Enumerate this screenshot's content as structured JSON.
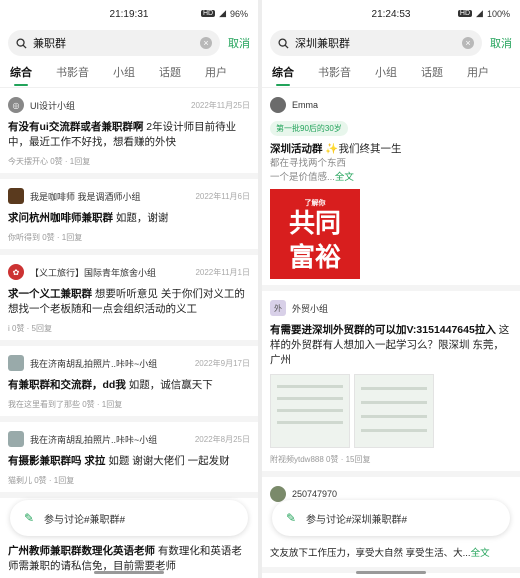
{
  "left": {
    "status": {
      "time": "21:19:31",
      "battery": "96%"
    },
    "search": {
      "query": "兼职群",
      "cancel": "取消"
    },
    "tabs": [
      "综合",
      "书影音",
      "小组",
      "话题",
      "用户"
    ],
    "posts": [
      {
        "group": "UI设计小组",
        "date": "2022年11月25日",
        "title": "有没有ui交流群或者兼职群啊",
        "body": " 2年设计师目前待业中，最近工作不好找，想看赚的外快",
        "stats": "今天摆开心 0赞 · 1回复"
      },
      {
        "group": "我是咖啡师 我是调酒师小组",
        "date": "2022年11月6日",
        "title": "求问杭州咖啡师兼职群",
        "body": " 如题，谢谢",
        "stats": "你听得到 0赞 · 1回复"
      },
      {
        "group": "【义工旅行】国际青年旅舍小组",
        "date": "2022年11月1日",
        "title": "求一个义工兼职群",
        "body": " 想要听听意见 关于你们对义工的 想找一个老板随和一点会组织活动的义工",
        "stats": "i 0赞 · 5回复"
      },
      {
        "group": "我在济南胡乱拍照片..咔咔~小组",
        "date": "2022年9月17日",
        "title": "有兼职群和交流群，dd我",
        "body": " 如题，诚信赢天下",
        "stats": "我在这里看到了那些 0赞 · 1回复"
      },
      {
        "group": "我在济南胡乱拍照片..咔咔~小组",
        "date": "2022年8月25日",
        "title": "有摄影兼职群吗 求拉",
        "body": " 如题 谢谢大佬们 一起发财",
        "stats": "猫剩儿 0赞 · 1回复"
      },
      {
        "group": "",
        "date": "",
        "title": "广州教师兼职群数理化英语老师",
        "body": " 有数理化和英语老师需兼职的请私信免，目前需要老师",
        "stats": ""
      }
    ],
    "bubble": "参与讨论#兼职群#"
  },
  "right": {
    "status": {
      "time": "21:24:53",
      "battery": "100%"
    },
    "search": {
      "query": "深圳兼职群",
      "cancel": "取消"
    },
    "tabs": [
      "综合",
      "书影音",
      "小组",
      "话题",
      "用户"
    ],
    "post1": {
      "user": "Emma",
      "badge": "第一批90后的30岁",
      "title": "深圳活动群",
      "line1": " ✨我们终其一生",
      "line2": "都在寻找两个东西",
      "line3": "一个是价值感...",
      "more": "全文",
      "poster_line1": "共同",
      "poster_line2": "富裕",
      "poster_top": "了解你"
    },
    "post2": {
      "group": "外贸小组",
      "title": "有需要进深圳外贸群的可以加V:3151447645拉入",
      "body": " 这样的外贸群有人想加入一起学习么？限深圳 东莞，广州",
      "stats": "附视频ytdw888 0赞 · 15回复"
    },
    "post3": {
      "user": "250747970",
      "line": "文友放下工作压力，享受大自然 享受生活、大...",
      "more": "全文"
    },
    "bubble": "参与讨论#深圳兼职群#"
  }
}
